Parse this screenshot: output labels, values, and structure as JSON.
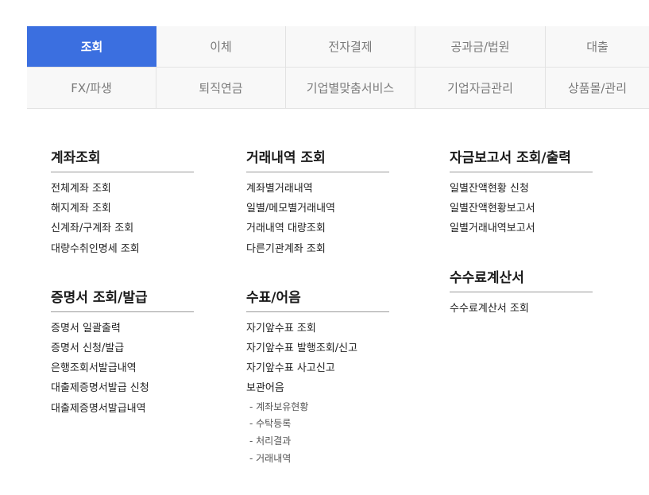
{
  "tabs": {
    "row1": [
      "조회",
      "이체",
      "전자결제",
      "공과금/법원",
      "대출"
    ],
    "row2": [
      "FX/파생",
      "퇴직연금",
      "기업별맞춤서비스",
      "기업자금관리",
      "상품몰/관리"
    ]
  },
  "sections": {
    "account": {
      "title": "계좌조회",
      "items": [
        "전체계좌 조회",
        "해지계좌 조회",
        "신계좌/구계좌 조회",
        "대량수취인명세 조회"
      ]
    },
    "certificate": {
      "title": "증명서 조회/발급",
      "items": [
        "증명서 일괄출력",
        "증명서 신청/발급",
        "은행조회서발급내역",
        "대출제증명서발급 신청",
        "대출제증명서발급내역"
      ]
    },
    "transactions": {
      "title": "거래내역 조회",
      "items": [
        "계좌별거래내역",
        "일별/메모별거래내역",
        "거래내역 대량조회",
        "다른기관계좌 조회"
      ]
    },
    "checks": {
      "title": "수표/어음",
      "items": [
        "자기앞수표 조회",
        "자기앞수표 발행조회/신고",
        "자기앞수표 사고신고",
        "보관어음"
      ],
      "subitems": [
        "- 계좌보유현황",
        "- 수탁등록",
        "- 처리결과",
        "- 거래내역"
      ]
    },
    "fund_report": {
      "title": "자금보고서 조회/출력",
      "items": [
        "일별잔액현황 신청",
        "일별잔액현황보고서",
        "일별거래내역보고서"
      ]
    },
    "fee": {
      "title": "수수료계산서",
      "items": [
        "수수료계산서 조회"
      ]
    }
  }
}
